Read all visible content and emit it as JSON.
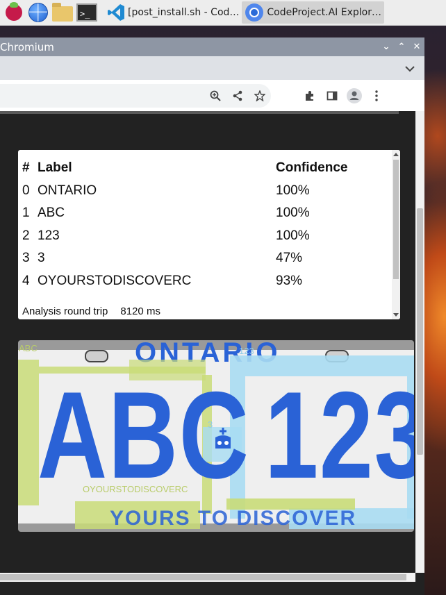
{
  "taskbar": {
    "tasks": [
      {
        "label": "[post_install.sh - Cod…",
        "icon": "vscode-icon"
      },
      {
        "label": "CodeProject.AI Explor…",
        "icon": "chromium-icon"
      }
    ]
  },
  "window": {
    "title": "Chromium"
  },
  "results": {
    "headers": [
      "#",
      "Label",
      "Confidence"
    ],
    "rows": [
      {
        "idx": "0",
        "label": "ONTARIO",
        "confidence": "100%"
      },
      {
        "idx": "1",
        "label": "ABC",
        "confidence": "100%"
      },
      {
        "idx": "2",
        "label": "123",
        "confidence": "100%"
      },
      {
        "idx": "3",
        "label": "3",
        "confidence": "47%"
      },
      {
        "idx": "4",
        "label": "OYOURSTODISCOVERC",
        "confidence": "93%"
      }
    ],
    "roundtrip_label": "Analysis round trip",
    "roundtrip_value": "8120 ms"
  },
  "plate": {
    "top_text": "ONTARIO",
    "left_text": "ABC",
    "right_text": "123",
    "bottom_text": "YOURS TO DISCOVER",
    "detection_labels": {
      "abc": "ABC",
      "n123": "123",
      "n3": "3",
      "slogan": "OYOURSTODISCOVERC"
    }
  },
  "colors": {
    "detection_box": "#c9dc78",
    "detection_box_alt": "#a8dcf2",
    "plate_text": "#2a62d6"
  }
}
